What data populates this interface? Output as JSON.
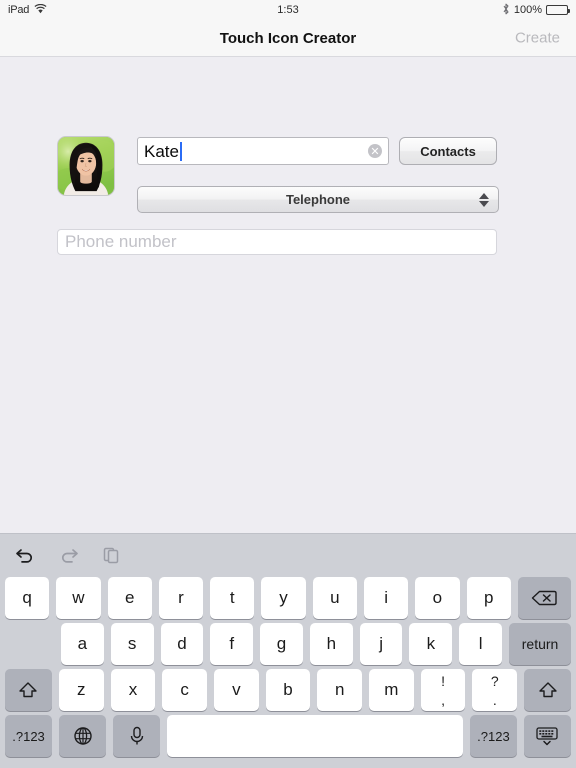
{
  "status_bar": {
    "device": "iPad",
    "wifi_icon": "wifi-icon",
    "time": "1:53",
    "bluetooth_icon": "bluetooth-icon",
    "battery_percent": "100%"
  },
  "nav_bar": {
    "title": "Touch Icon Creator",
    "right_action": "Create",
    "right_action_disabled": true
  },
  "form": {
    "avatar_alt": "contact-photo",
    "name_value": "Kate",
    "clear_icon": "✕",
    "contacts_label": "Contacts",
    "type_value": "Telephone",
    "phone_placeholder": "Phone number"
  },
  "keyboard": {
    "toolbar": [
      {
        "name": "undo-icon",
        "label": "undo"
      },
      {
        "name": "redo-icon",
        "label": "redo"
      },
      {
        "name": "paste-icon",
        "label": "paste"
      }
    ],
    "row1": [
      "q",
      "w",
      "e",
      "r",
      "t",
      "y",
      "u",
      "i",
      "o",
      "p"
    ],
    "backspace_label": "⌫",
    "row2": [
      "a",
      "s",
      "d",
      "f",
      "g",
      "h",
      "j",
      "k",
      "l"
    ],
    "return_label": "return",
    "row3": [
      "z",
      "x",
      "c",
      "v",
      "b",
      "n",
      "m"
    ],
    "shift_label": "⇧",
    "punct1_top": "!",
    "punct1_bottom": ",",
    "punct2_top": "?",
    "punct2_bottom": ".",
    "numeric_label": ".?123",
    "globe_label": "globe",
    "mic_label": "microphone",
    "space_label": "",
    "hide_label": "hide-keyboard"
  },
  "colors": {
    "body_bg": "#eeedf2",
    "bar_bg": "#f7f7f7",
    "keyboard_bg": "#ced0d6",
    "key_bg": "#ffffff",
    "key_dark_bg": "#aeb1ba",
    "caret": "#2b6cf5",
    "disabled_text": "#b9b9bd"
  }
}
